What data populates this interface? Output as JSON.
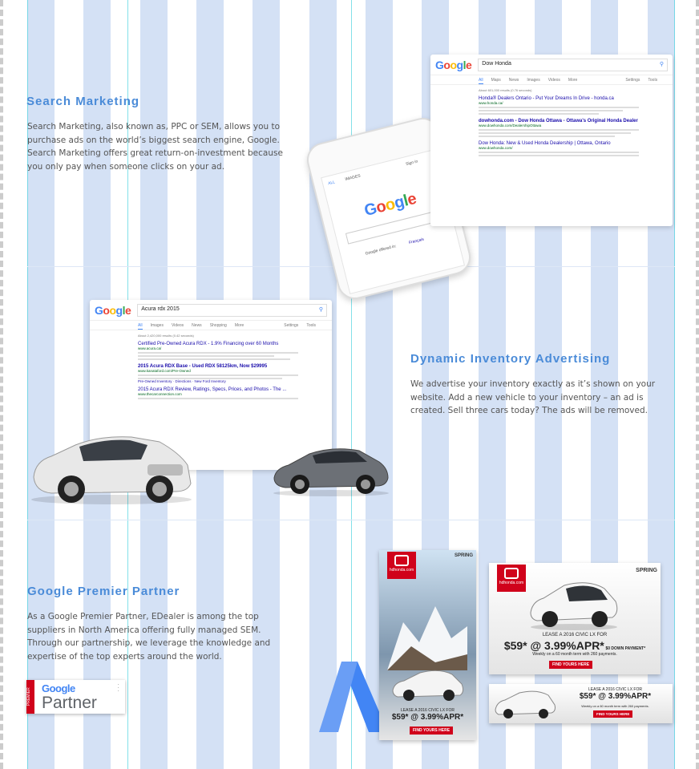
{
  "sections": {
    "search": {
      "title": "Search Marketing",
      "body": "Search Marketing, also known as, PPC or SEM, allows you to purchase ads on the world’s biggest search engine, Google. Search Marketing offers great return-on-investment because you only pay when someone clicks on your ad."
    },
    "dynamic": {
      "title": "Dynamic Inventory Advertising",
      "body": "We advertise your inventory exactly as it’s shown on your website. Add a new vehicle to your inventory – an ad is created. Sell three cars today? The ads will be removed."
    },
    "partner": {
      "title": "Google Premier Partner",
      "body": "As a Google Premier Partner, EDealer is among the top suppliers in North America offering fully managed SEM. Through our partnership, we leverage the knowledge and expertise of the top experts around the world."
    }
  },
  "serp1": {
    "query": "Dow Honda",
    "tabs": [
      "All",
      "Maps",
      "News",
      "Images",
      "Videos",
      "More",
      "Settings",
      "Tools"
    ],
    "stats": "About 601,000 results (0.76 seconds)",
    "results": [
      {
        "title": "Honda® Dealers Ontario - Put Your Dreams In Drive - honda.ca",
        "url": "www.honda.ca/"
      },
      {
        "title": "dowhonda.com - Dow Honda Ottawa - Ottawa's Original Honda Dealer",
        "url": "www.dowhonda.com/DealershipOttawa"
      },
      {
        "title": "Dow Honda: New & Used Honda Dealership | Ottawa, Ontario",
        "url": "www.dowhonda.com/"
      }
    ]
  },
  "serp2": {
    "query": "Acura rdx 2015",
    "tabs": [
      "All",
      "Images",
      "Videos",
      "News",
      "Shopping",
      "More",
      "Settings",
      "Tools"
    ],
    "stats": "About 2,420,000 results (0.42 seconds)",
    "results": [
      {
        "title": "Certified Pre-Owned Acura RDX - 1.9% Financing over 60 Months",
        "url": "www.acura.ca/"
      },
      {
        "title": "2015 Acura RDX Base - Used RDX 58125km, Now $29995",
        "url": "www.kanataford.com/Pre-Owned"
      },
      {
        "title": "2015 Acura RDX Review, Ratings, Specs, Prices, and Photos - The ...",
        "url": "www.thecarconnection.com"
      }
    ],
    "links": "Pre-Owned Inventory · Directions · New Ford Inventory"
  },
  "phone": {
    "tab_all": "ALL",
    "tab_images": "IMAGES",
    "signin": "Sign in",
    "offered": "Google offered in:",
    "lang": "Français"
  },
  "ads": {
    "brand": "hdhonda.com",
    "event": "SPRING",
    "lease": "LEASE A 2016 CIVIC LX FOR",
    "price": "$59* @ 3.99%APR*",
    "down": "$0 DOWN PAYMENT*",
    "term": "Weekly on a 60 month term with 260 payments.",
    "cta": "FIND YOURS HERE"
  },
  "partner_badge": {
    "side": "PREMIER",
    "google": "Google",
    "label": "Partner"
  },
  "colors": {
    "accent": "#4a8bd8",
    "column": "#d4e1f5",
    "honda_red": "#d0021b"
  }
}
